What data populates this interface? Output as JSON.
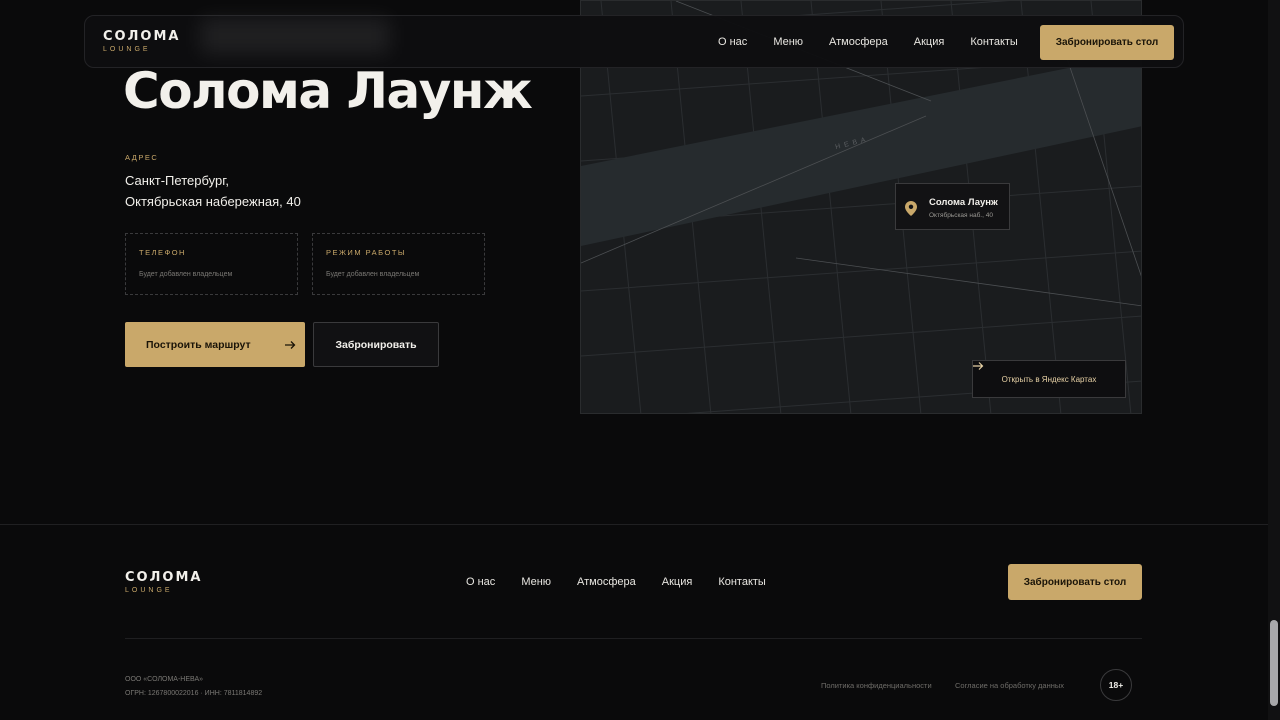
{
  "brand": {
    "name": "СОЛОМА",
    "sub": "LOUNGE"
  },
  "nav": [
    "О нас",
    "Меню",
    "Атмосфера",
    "Акция",
    "Контакты"
  ],
  "header": {
    "cta": "Забронировать стол"
  },
  "hero": {
    "ghost_title": "",
    "title": "Солома Лаунж",
    "address_label": "АДРЕС",
    "address_line1": "Санкт-Петербург,",
    "address_line2": "Октябрьская набережная, 40",
    "phone_label": "ТЕЛЕФОН",
    "phone_value": "Будет добавлен владельцем",
    "hours_label": "РЕЖИМ РАБОТЫ",
    "hours_value": "Будет добавлен владельцем",
    "route_button": "Построить маршрут",
    "book_button": "Забронировать"
  },
  "map": {
    "river_label": "НЕВА",
    "pin_title": "Солома Лаунж",
    "pin_subtitle": "Октябрьская наб., 40",
    "open_button": "Открыть в Яндекс Картах"
  },
  "footer": {
    "cta": "Забронировать стол",
    "company": "ООО «СОЛОМА-НЕВА»",
    "registration": "ОГРН: 1267800022016 · ИНН: 7811814892",
    "privacy": "Политика конфиденциальности",
    "consent": "Согласие на обработку данных",
    "age": "18+"
  },
  "colors": {
    "accent": "#c9a86a",
    "background": "#0a0a0b",
    "text": "#f2f0eb"
  }
}
